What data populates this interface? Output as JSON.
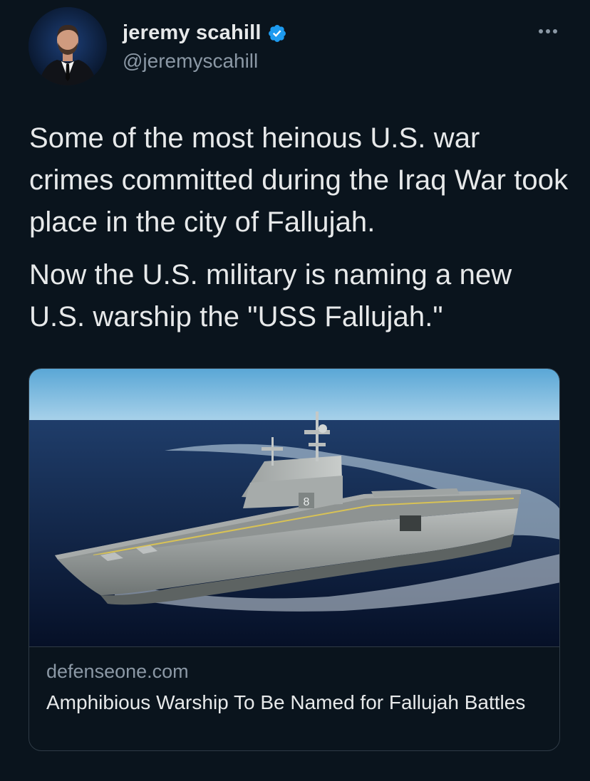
{
  "author": {
    "display_name": "jeremy scahill",
    "handle": "@jeremyscahill",
    "verified": true
  },
  "menu": {
    "icon": "more-horizontal-icon"
  },
  "tweet": {
    "paragraphs": [
      "Some of the most heinous U.S. war crimes committed during the Iraq War took place in the city of Fallujah.",
      "Now the U.S. military is naming a new U.S. warship the \"USS Fallujah.\""
    ]
  },
  "link_card": {
    "domain": "defenseone.com",
    "title": "Amphibious Warship To Be Named for Fallujah Battles",
    "image": "amphibious-assault-ship-photo"
  },
  "colors": {
    "background": "#0a141d",
    "text_primary": "#e7e9ea",
    "text_secondary": "#8b98a5",
    "verified_badge": "#1d9bf0",
    "border": "#2f3b46"
  }
}
